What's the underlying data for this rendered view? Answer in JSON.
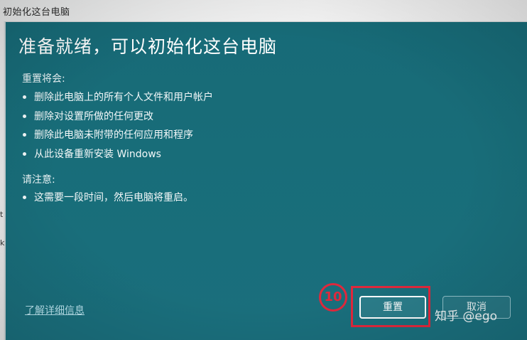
{
  "window": {
    "title": "初始化这台电脑"
  },
  "left_edge_fragments": [
    "t",
    "k"
  ],
  "dialog": {
    "heading": "准备就绪，可以初始化这台电脑",
    "reset_section": {
      "label": "重置将会:",
      "items": [
        "删除此电脑上的所有个人文件和用户帐户",
        "删除对设置所做的任何更改",
        "删除此电脑未附带的任何应用和程序",
        "从此设备重新安装 Windows"
      ]
    },
    "note_section": {
      "label": "请注意:",
      "items": [
        "这需要一段时间，然后电脑将重启。"
      ]
    },
    "learn_more_link": "了解详细信息",
    "buttons": {
      "reset": "重置",
      "cancel": "取消"
    }
  },
  "annotation": {
    "step_number": "10",
    "highlight_color": "#e0283c"
  },
  "watermark": "知乎 @ego"
}
